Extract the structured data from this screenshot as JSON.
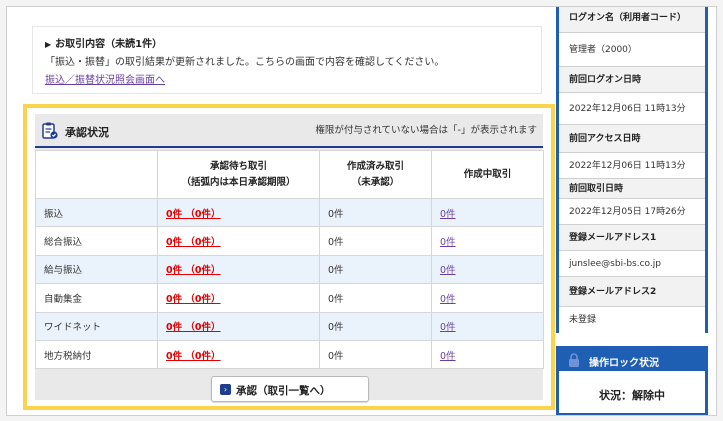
{
  "notice": {
    "title": "お取引内容（未読1件）",
    "body": "「振込・振替」の取引結果が更新されました。こちらの画面で内容を確認してください。",
    "link": "振込／振替状況照会画面へ"
  },
  "approval": {
    "title": "承認状況",
    "note": "権限が付与されていない場合は「-」が表示されます",
    "columns": [
      {
        "line1": "承認待ち取引",
        "line2": "（括弧内は本日承認期限）"
      },
      {
        "line1": "作成済み取引",
        "line2": "（未承認）"
      },
      {
        "line1": "作成中取引",
        "line2": ""
      }
    ],
    "rows": [
      {
        "label": "振込",
        "pending": "0件 （0件）",
        "created": "0件",
        "draft": "0件"
      },
      {
        "label": "総合振込",
        "pending": "0件 （0件）",
        "created": "0件",
        "draft": "0件"
      },
      {
        "label": "給与振込",
        "pending": "0件 （0件）",
        "created": "0件",
        "draft": "0件"
      },
      {
        "label": "自動集金",
        "pending": "0件 （0件）",
        "created": "0件",
        "draft": "0件"
      },
      {
        "label": "ワイドネット",
        "pending": "0件 （0件）",
        "created": "0件",
        "draft": "0件"
      },
      {
        "label": "地方税納付",
        "pending": "0件 （0件）",
        "created": "0件",
        "draft": "0件"
      }
    ],
    "button": "承認（取引一覧へ）"
  },
  "sidebar": {
    "logon_header": "ログオン名（利用者コード）",
    "logon_value": "管理者（2000）",
    "last_logon_header": "前回ログオン日時",
    "last_logon_value": "2022年12月06日 11時13分",
    "last_access_header": "前回アクセス日時",
    "last_access_value": "2022年12月06日 11時13分",
    "last_trade_header": "前回取引日時",
    "last_trade_value": "2022年12月05日 17時26分",
    "email1_header": "登録メールアドレス1",
    "email1_value": "junslee@sbi-bs.co.jp",
    "email2_header": "登録メールアドレス2",
    "email2_value": "未登録"
  },
  "lock": {
    "title": "操作ロック状況",
    "status": "状況：解除中"
  },
  "colors": {
    "accent_yellow": "#f9d44c",
    "navy": "#1f3d8c",
    "blue": "#1e5fb4",
    "link_red": "#e00000",
    "link_purple": "#6a3fa0"
  }
}
